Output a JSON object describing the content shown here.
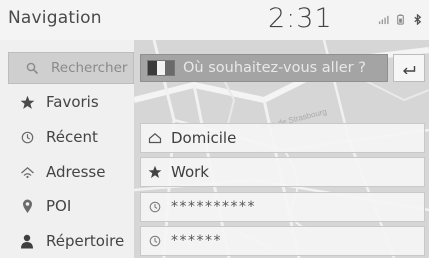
{
  "header": {
    "title": "Navigation",
    "clock": "2:31",
    "status_icons": [
      "signal-icon",
      "battery-icon",
      "bluetooth-icon"
    ]
  },
  "sidebar": {
    "items": [
      {
        "label": "Rechercher",
        "icon": "search-icon",
        "active": true
      },
      {
        "label": "Favoris",
        "icon": "star-icon"
      },
      {
        "label": "Récent",
        "icon": "clock-icon"
      },
      {
        "label": "Adresse",
        "icon": "address-icon"
      },
      {
        "label": "POI",
        "icon": "pin-icon"
      },
      {
        "label": "Répertoire",
        "icon": "person-icon"
      }
    ]
  },
  "search": {
    "placeholder": "Où souhaitez-vous aller ?",
    "flag_colors": [
      "#3a3a3a",
      "#f2f2f2",
      "#6a6a6a"
    ]
  },
  "results": [
    {
      "label": "Domicile",
      "icon": "home-icon"
    },
    {
      "label": "Work",
      "icon": "star-icon"
    },
    {
      "label": "**********",
      "icon": "clock-icon"
    },
    {
      "label": "******",
      "icon": "clock-icon"
    }
  ],
  "map": {
    "road_label": "Rue de Strasbourg"
  },
  "colors": {
    "background": "#efefef",
    "active_sidebar": "#cfcfcf",
    "search_bar": "#a4a4a4"
  }
}
